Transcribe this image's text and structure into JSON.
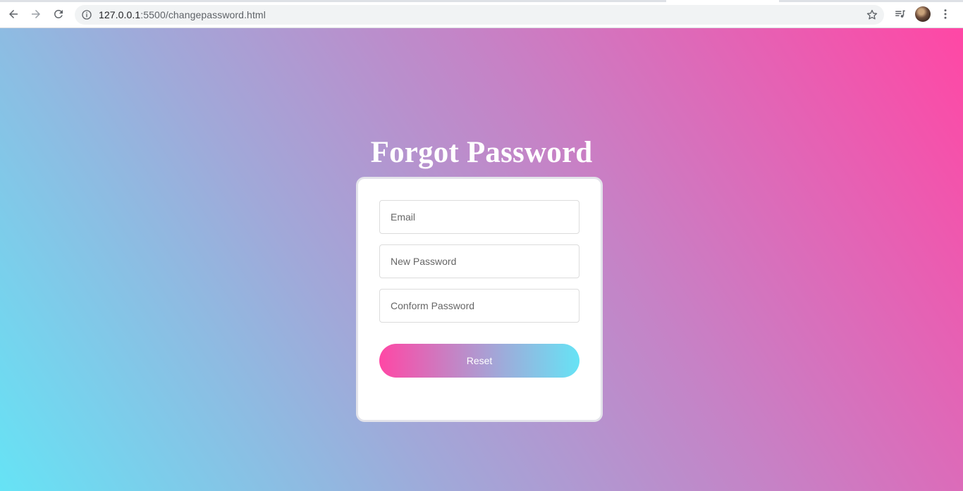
{
  "browser": {
    "url_host": "127.0.0.1",
    "url_path": ":5500/changepassword.html"
  },
  "page": {
    "title": "Forgot Password"
  },
  "form": {
    "email_placeholder": "Email",
    "new_password_placeholder": "New Password",
    "confirm_password_placeholder": "Conform Password",
    "reset_label": "Reset"
  },
  "colors": {
    "gradient_pink": "#ff47a5",
    "gradient_cyan": "#66e3f5"
  },
  "icons": [
    "back-icon",
    "forward-icon",
    "reload-icon",
    "info-icon",
    "star-icon",
    "playlist-icon",
    "more-vert-icon"
  ]
}
